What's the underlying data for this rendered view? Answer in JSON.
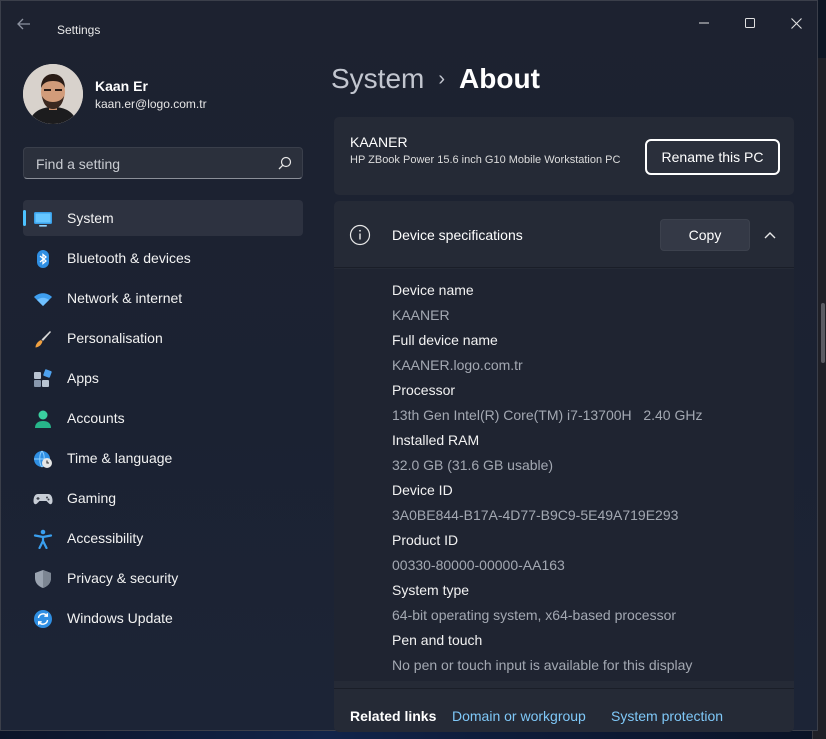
{
  "app": {
    "title": "Settings"
  },
  "window_controls": {
    "minimize": "minimize-icon",
    "maximize": "maximize-icon",
    "close": "close-icon"
  },
  "user": {
    "name": "Kaan Er",
    "email": "kaan.er@logo.com.tr"
  },
  "search": {
    "placeholder": "Find a setting",
    "value": ""
  },
  "sidebar": {
    "items": [
      {
        "label": "System",
        "icon": "system-display-icon",
        "active": true
      },
      {
        "label": "Bluetooth & devices",
        "icon": "bluetooth-icon"
      },
      {
        "label": "Network & internet",
        "icon": "wifi-icon"
      },
      {
        "label": "Personalisation",
        "icon": "paintbrush-icon"
      },
      {
        "label": "Apps",
        "icon": "apps-icon"
      },
      {
        "label": "Accounts",
        "icon": "person-icon"
      },
      {
        "label": "Time & language",
        "icon": "globe-clock-icon"
      },
      {
        "label": "Gaming",
        "icon": "gamepad-icon"
      },
      {
        "label": "Accessibility",
        "icon": "accessibility-icon"
      },
      {
        "label": "Privacy & security",
        "icon": "shield-icon"
      },
      {
        "label": "Windows Update",
        "icon": "update-icon"
      }
    ]
  },
  "breadcrumb": {
    "parent": "System",
    "separator": "›",
    "current": "About"
  },
  "pc": {
    "name": "KAANER",
    "model": "HP ZBook Power 15.6 inch G10 Mobile Workstation PC",
    "rename_label": "Rename this PC"
  },
  "specs": {
    "title": "Device specifications",
    "copy_label": "Copy",
    "rows": [
      {
        "label": "Device name",
        "value": "KAANER"
      },
      {
        "label": "Full device name",
        "value": "KAANER.logo.com.tr"
      },
      {
        "label": "Processor",
        "value": "13th Gen Intel(R) Core(TM) i7-13700H   2.40 GHz"
      },
      {
        "label": "Installed RAM",
        "value": "32.0 GB (31.6 GB usable)"
      },
      {
        "label": "Device ID",
        "value": "3A0BE844-B17A-4D77-B9C9-5E49A719E293"
      },
      {
        "label": "Product ID",
        "value": "00330-80000-00000-AA163"
      },
      {
        "label": "System type",
        "value": "64-bit operating system, x64-based processor"
      },
      {
        "label": "Pen and touch",
        "value": "No pen or touch input is available for this display"
      }
    ]
  },
  "related": {
    "label": "Related links",
    "links": [
      "Domain or workgroup",
      "System protection"
    ]
  },
  "colors": {
    "accent": "#4cc2ff",
    "link": "#7fc8f8"
  }
}
